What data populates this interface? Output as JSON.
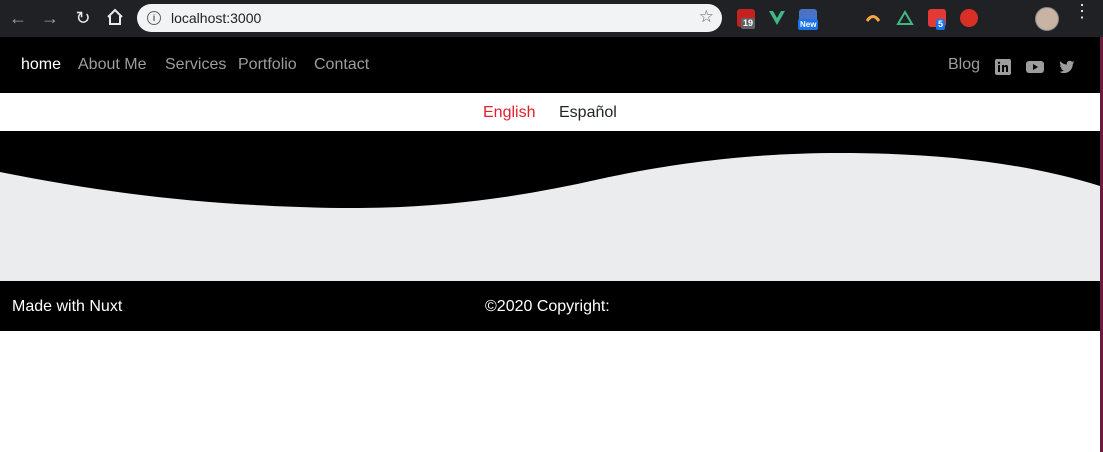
{
  "browser": {
    "url": "localhost:3000",
    "badges": {
      "calendar": "19",
      "new": "New",
      "counter": "5"
    }
  },
  "site": {
    "nav": [
      {
        "label": "home",
        "active": true
      },
      {
        "label": "About Me",
        "active": false
      },
      {
        "label": "Services",
        "active": false
      },
      {
        "label": "Portfolio",
        "active": false
      },
      {
        "label": "Contact",
        "active": false
      }
    ],
    "blog_label": "Blog",
    "social": [
      "linkedin-icon",
      "youtube-icon",
      "twitter-icon"
    ]
  },
  "language": {
    "english": "English",
    "spanish": "Español",
    "active_color": "#e0202f"
  },
  "footer": {
    "made_with": "Made with Nuxt",
    "copyright": "©2020 Copyright:"
  },
  "colors": {
    "nav_bg": "#000000",
    "hero_bg": "#eaeced",
    "nav_link": "#9d9d9d"
  }
}
